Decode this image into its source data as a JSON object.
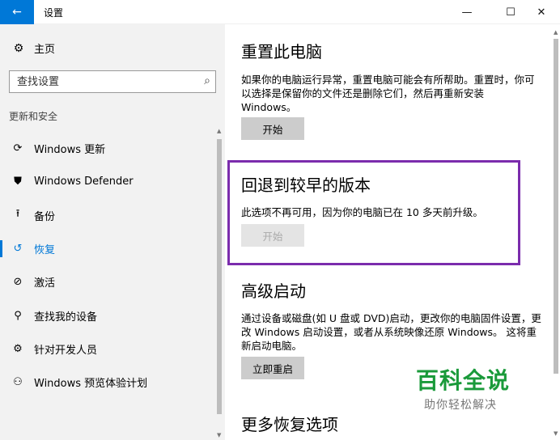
{
  "window": {
    "back_icon": "←",
    "title": "设置",
    "minimize_icon": "—",
    "maximize_icon": "☐",
    "close_icon": "✕"
  },
  "sidebar": {
    "home_icon": "⚙",
    "home_label": "主页",
    "search_placeholder": "查找设置",
    "search_icon": "⌕",
    "section_label": "更新和安全",
    "items": [
      {
        "icon": "⟳",
        "label": "Windows 更新"
      },
      {
        "icon": "⛊",
        "label": "Windows Defender"
      },
      {
        "icon": "⭱",
        "label": "备份"
      },
      {
        "icon": "↺",
        "label": "恢复"
      },
      {
        "icon": "⊘",
        "label": "激活"
      },
      {
        "icon": "⚲",
        "label": "查找我的设备"
      },
      {
        "icon": "⚙",
        "label": "针对开发人员"
      },
      {
        "icon": "⚇",
        "label": "Windows 预览体验计划"
      }
    ],
    "active_index": 3
  },
  "main": {
    "reset": {
      "heading": "重置此电脑",
      "description": "如果你的电脑运行异常，重置电脑可能会有所帮助。重置时，你可以选择是保留你的文件还是删除它们，然后再重新安装 Windows。",
      "button": "开始"
    },
    "rollback": {
      "heading": "回退到较早的版本",
      "description": "此选项不再可用，因为你的电脑已在 10 多天前升级。",
      "button": "开始"
    },
    "advanced": {
      "heading": "高级启动",
      "description": "通过设备或磁盘(如 U 盘或 DVD)启动，更改你的电脑固件设置，更改 Windows 启动设置，或者从系统映像还原 Windows。 这将重新启动电脑。",
      "button": "立即重启"
    },
    "more": {
      "heading": "更多恢复选项"
    }
  },
  "watermark": {
    "title": "百科全说",
    "subtitle": "助你轻松解决"
  },
  "colors": {
    "accent": "#0078d7",
    "highlight_border": "#7b2cad",
    "watermark_green": "#1a9a3a"
  }
}
